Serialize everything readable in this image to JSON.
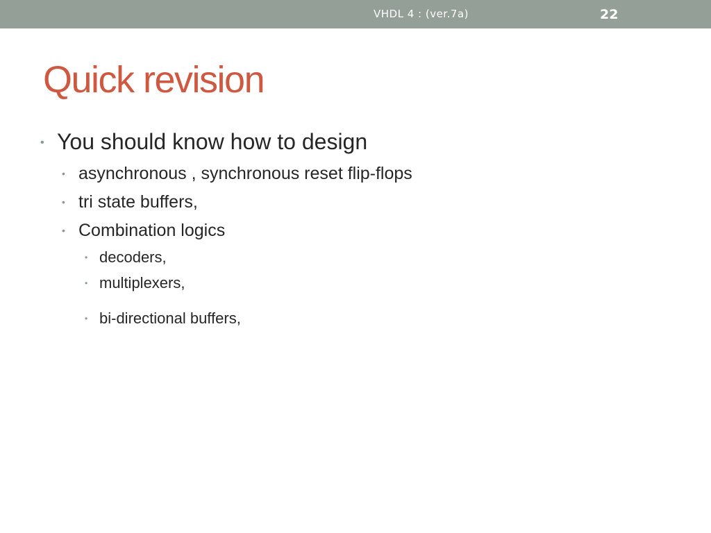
{
  "header": {
    "text": "VHDL 4 : (ver.7a)",
    "page_number": "22"
  },
  "title": "Quick revision",
  "bullets": {
    "main": "You should know how to design",
    "sub1": "asynchronous , synchronous reset flip-flops",
    "sub2": "tri state buffers,",
    "sub3": "Combination logics",
    "sub3_1": "decoders,",
    "sub3_2": "multiplexers,",
    "sub3_3": "bi-directional buffers,"
  },
  "colors": {
    "header_bar": "#939f97",
    "title": "#cf5840",
    "body_text": "#262626",
    "bullet": "#8a9790"
  }
}
